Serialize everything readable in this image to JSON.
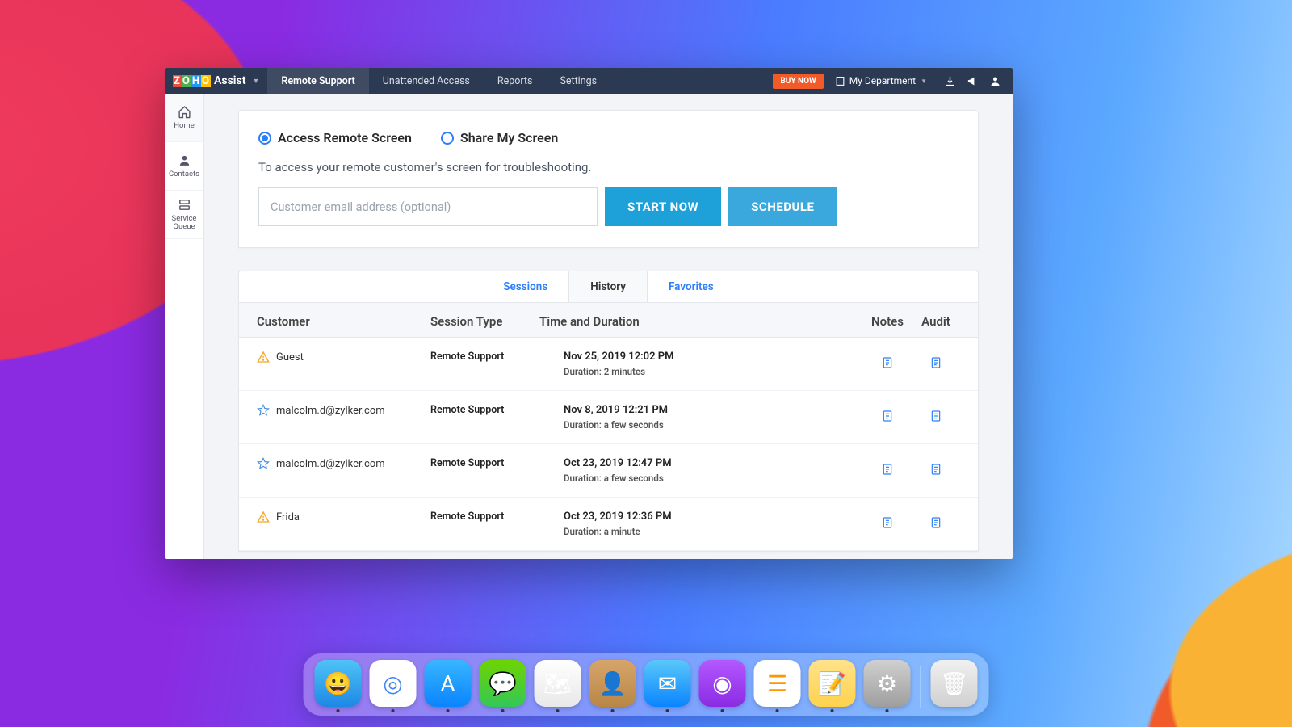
{
  "top_nav": {
    "logo_product": "Assist",
    "tabs": [
      "Remote Support",
      "Unattended Access",
      "Reports",
      "Settings"
    ],
    "active_tab": 0,
    "buy_now": "BUY NOW",
    "department": "My Department"
  },
  "sidebar": {
    "items": [
      {
        "label": "Home",
        "icon": "home"
      },
      {
        "label": "Contacts",
        "icon": "user"
      },
      {
        "label": "Service\nQueue",
        "icon": "servers"
      }
    ],
    "active": 0
  },
  "access": {
    "radio_access": "Access Remote Screen",
    "radio_share": "Share My Screen",
    "selected": "access",
    "description": "To access your remote customer's screen for troubleshooting.",
    "email_placeholder": "Customer email address (optional)",
    "start_label": "START NOW",
    "schedule_label": "SCHEDULE"
  },
  "history": {
    "sub_tabs": [
      "Sessions",
      "History",
      "Favorites"
    ],
    "active_sub": 1,
    "columns": {
      "customer": "Customer",
      "type": "Session Type",
      "time": "Time and Duration",
      "notes": "Notes",
      "audit": "Audit"
    },
    "rows": [
      {
        "icon": "warn",
        "customer": "Guest",
        "type": "Remote Support",
        "time": "Nov 25, 2019 12:02 PM",
        "duration": "Duration: 2 minutes"
      },
      {
        "icon": "star",
        "customer": "malcolm.d@zylker.com",
        "type": "Remote Support",
        "time": "Nov 8, 2019 12:21 PM",
        "duration": "Duration: a few seconds"
      },
      {
        "icon": "star",
        "customer": "malcolm.d@zylker.com",
        "type": "Remote Support",
        "time": "Oct 23, 2019 12:47 PM",
        "duration": "Duration: a few seconds"
      },
      {
        "icon": "warn",
        "customer": "Frida",
        "type": "Remote Support",
        "time": "Oct 23, 2019 12:36 PM",
        "duration": "Duration: a minute"
      }
    ]
  },
  "dock": {
    "apps": [
      {
        "name": "finder",
        "bg": "linear-gradient(#4fc3f7,#1e88e5)",
        "glyph": "😀"
      },
      {
        "name": "chrome",
        "bg": "#fff",
        "glyph": "◎"
      },
      {
        "name": "appstore",
        "bg": "linear-gradient(#38b6ff,#0a84ff)",
        "glyph": "A"
      },
      {
        "name": "messages",
        "bg": "linear-gradient(#6dd400,#34c759)",
        "glyph": "💬"
      },
      {
        "name": "maps",
        "bg": "linear-gradient(#fff,#e8e8e8)",
        "glyph": "🗺"
      },
      {
        "name": "contacts",
        "bg": "linear-gradient(#d7a56a,#b88746)",
        "glyph": "👤"
      },
      {
        "name": "mail",
        "bg": "linear-gradient(#5ac8fa,#0a84ff)",
        "glyph": "✉"
      },
      {
        "name": "podcasts",
        "bg": "linear-gradient(#b458ff,#8a2be2)",
        "glyph": "◉"
      },
      {
        "name": "reminders",
        "bg": "#fff",
        "glyph": "☰"
      },
      {
        "name": "notes",
        "bg": "linear-gradient(#ffe28a,#ffd24d)",
        "glyph": "📝"
      },
      {
        "name": "settings",
        "bg": "linear-gradient(#d0d0d0,#9e9e9e)",
        "glyph": "⚙"
      },
      {
        "name": "trash",
        "bg": "linear-gradient(#f0f0f0,#d0d0d0)",
        "glyph": "🗑"
      }
    ]
  }
}
